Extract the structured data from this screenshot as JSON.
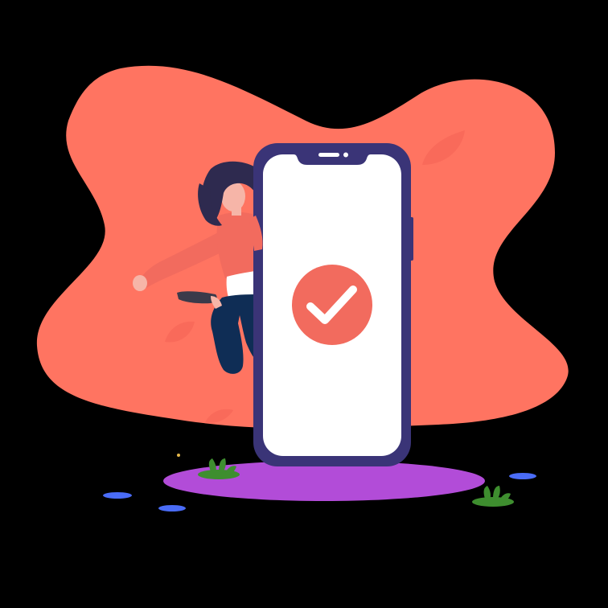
{
  "illustration": {
    "subject": "woman-jumping-beside-smartphone-with-checkmark",
    "icons": [
      "phone-icon",
      "check-icon",
      "woman-figure",
      "plant-icon",
      "leaf-icon"
    ]
  },
  "colors": {
    "background": "#000000",
    "blob": "#FF7461",
    "blob_leaf": "#F8695A",
    "phone_frame": "#3A3477",
    "phone_screen": "#FFFFFF",
    "check_circle": "#F26B5E",
    "check_mark": "#FFFFFF",
    "shadow": "#B24CD8",
    "puddles": "#4A6CF7",
    "plants": "#3E8E2F",
    "hair": "#2E2A4F",
    "skin": "#F6B5A8",
    "shirt": "#F26B5E",
    "pants": "#0F2D55"
  }
}
